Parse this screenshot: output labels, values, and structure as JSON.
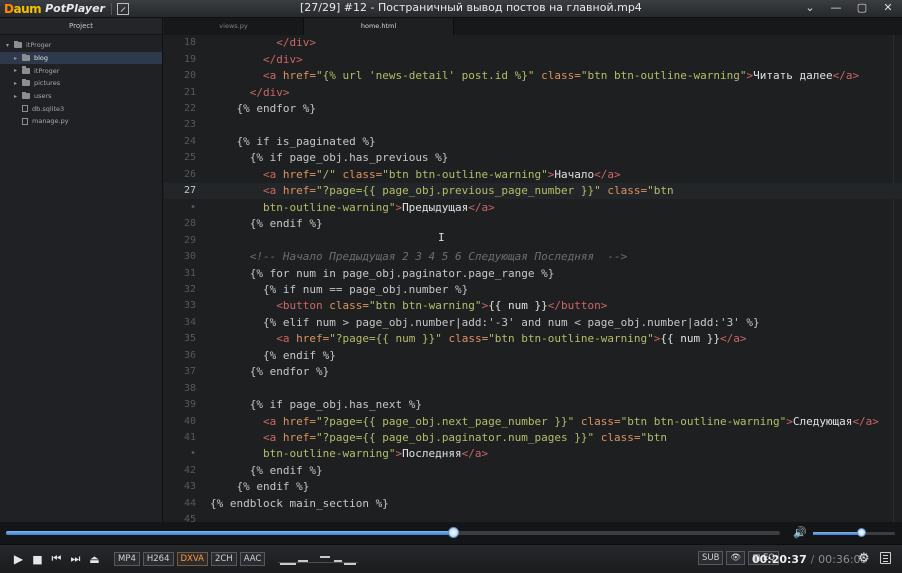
{
  "player": {
    "logo": "Daum",
    "app_name": "PotPlayer",
    "title": "[27/29] #12 - Постраничный вывод постов на главной.mp4",
    "window_buttons": [
      "⌄",
      "—",
      "▢",
      "✕"
    ]
  },
  "sidebar": {
    "header": "Project",
    "items": [
      {
        "label": "itProger",
        "kind": "folder",
        "level": 0,
        "selected": false
      },
      {
        "label": "blog",
        "kind": "folder",
        "level": 1,
        "selected": true
      },
      {
        "label": "itProger",
        "kind": "folder",
        "level": 1,
        "selected": false
      },
      {
        "label": "pictures",
        "kind": "folder",
        "level": 1,
        "selected": false
      },
      {
        "label": "users",
        "kind": "folder",
        "level": 1,
        "selected": false
      },
      {
        "label": "db.sqlite3",
        "kind": "file",
        "level": 1,
        "selected": false
      },
      {
        "label": "manage.py",
        "kind": "file",
        "level": 1,
        "selected": false
      }
    ]
  },
  "tabs": [
    {
      "label": "views.py",
      "active": false
    },
    {
      "label": "home.html",
      "active": true
    }
  ],
  "editor": {
    "current_line": "27",
    "lines": [
      {
        "n": "18",
        "indent": 10,
        "tokens": [
          [
            "tag",
            "</div>"
          ]
        ]
      },
      {
        "n": "19",
        "indent": 8,
        "tokens": [
          [
            "tag",
            "</div>"
          ]
        ]
      },
      {
        "n": "20",
        "indent": 8,
        "tokens": [
          [
            "tag",
            "<a "
          ],
          [
            "attr",
            "href="
          ],
          [
            "str",
            "\"{% url 'news-detail' post.id %}\""
          ],
          [
            "attr",
            " class="
          ],
          [
            "str",
            "\"btn btn-outline-warning\""
          ],
          [
            "tag",
            ">"
          ],
          [
            "txt",
            "Читать далее"
          ],
          [
            "tag",
            "</a>"
          ]
        ]
      },
      {
        "n": "21",
        "indent": 6,
        "tokens": [
          [
            "tag",
            "</div>"
          ]
        ]
      },
      {
        "n": "22",
        "indent": 4,
        "tokens": [
          [
            "tpl",
            "{% endfor %}"
          ]
        ]
      },
      {
        "n": "23",
        "indent": 0,
        "tokens": []
      },
      {
        "n": "24",
        "indent": 4,
        "tokens": [
          [
            "tpl",
            "{% if is_paginated %}"
          ]
        ]
      },
      {
        "n": "25",
        "indent": 6,
        "tokens": [
          [
            "tpl",
            "{% if page_obj.has_previous %}"
          ]
        ]
      },
      {
        "n": "26",
        "indent": 8,
        "tokens": [
          [
            "tag",
            "<a "
          ],
          [
            "attr",
            "href="
          ],
          [
            "str",
            "\"/\""
          ],
          [
            "attr",
            " class="
          ],
          [
            "str",
            "\"btn btn-outline-warning\""
          ],
          [
            "tag",
            ">"
          ],
          [
            "txt",
            "Начало"
          ],
          [
            "tag",
            "</a>"
          ]
        ]
      },
      {
        "n": "27",
        "indent": 8,
        "tokens": [
          [
            "tag",
            "<a "
          ],
          [
            "attr",
            "href="
          ],
          [
            "str",
            "\"?page={{ page_obj.previous_page_number }}\""
          ],
          [
            "attr",
            " class="
          ],
          [
            "str",
            "\"btn"
          ]
        ]
      },
      {
        "n": "•",
        "indent": 8,
        "tokens": [
          [
            "str",
            "btn-outline-warning\""
          ],
          [
            "tag",
            ">"
          ],
          [
            "txt",
            "Предыдущая"
          ],
          [
            "tag",
            "</a>"
          ]
        ]
      },
      {
        "n": "28",
        "indent": 6,
        "tokens": [
          [
            "tpl",
            "{% endif %}"
          ]
        ]
      },
      {
        "n": "29",
        "indent": 0,
        "tokens": []
      },
      {
        "n": "30",
        "indent": 6,
        "tokens": [
          [
            "cmt",
            "<!-- Начало Предыдущая 2 3 4 5 6 Следующая Последняя  -->"
          ]
        ]
      },
      {
        "n": "31",
        "indent": 6,
        "tokens": [
          [
            "tpl",
            "{% for num in page_obj.paginator.page_range %}"
          ]
        ]
      },
      {
        "n": "32",
        "indent": 8,
        "tokens": [
          [
            "tpl",
            "{% if num == page_obj.number %}"
          ]
        ]
      },
      {
        "n": "33",
        "indent": 10,
        "tokens": [
          [
            "tag",
            "<button "
          ],
          [
            "attr",
            "class="
          ],
          [
            "str",
            "\"btn btn-warning\""
          ],
          [
            "tag",
            ">"
          ],
          [
            "txt",
            "{{ num }}"
          ],
          [
            "tag",
            "</button>"
          ]
        ]
      },
      {
        "n": "34",
        "indent": 8,
        "tokens": [
          [
            "tpl",
            "{% elif num > page_obj.number|add:'-3' and num < page_obj.number|add:'3' %}"
          ]
        ]
      },
      {
        "n": "35",
        "indent": 10,
        "tokens": [
          [
            "tag",
            "<a "
          ],
          [
            "attr",
            "href="
          ],
          [
            "str",
            "\"?page={{ num }}\""
          ],
          [
            "attr",
            " class="
          ],
          [
            "str",
            "\"btn btn-outline-warning\""
          ],
          [
            "tag",
            ">"
          ],
          [
            "txt",
            "{{ num }}"
          ],
          [
            "tag",
            "</a>"
          ]
        ]
      },
      {
        "n": "36",
        "indent": 8,
        "tokens": [
          [
            "tpl",
            "{% endif %}"
          ]
        ]
      },
      {
        "n": "37",
        "indent": 6,
        "tokens": [
          [
            "tpl",
            "{% endfor %}"
          ]
        ]
      },
      {
        "n": "38",
        "indent": 0,
        "tokens": []
      },
      {
        "n": "39",
        "indent": 6,
        "tokens": [
          [
            "tpl",
            "{% if page_obj.has_next %}"
          ]
        ]
      },
      {
        "n": "40",
        "indent": 8,
        "tokens": [
          [
            "tag",
            "<a "
          ],
          [
            "attr",
            "href="
          ],
          [
            "str",
            "\"?page={{ page_obj.next_page_number }}\""
          ],
          [
            "attr",
            " class="
          ],
          [
            "str",
            "\"btn btn-outline-warning\""
          ],
          [
            "tag",
            ">"
          ],
          [
            "txt",
            "Следующая"
          ],
          [
            "tag",
            "</a>"
          ]
        ]
      },
      {
        "n": "41",
        "indent": 8,
        "tokens": [
          [
            "tag",
            "<a "
          ],
          [
            "attr",
            "href="
          ],
          [
            "str",
            "\"?page={{ page_obj.paginator.num_pages }}\""
          ],
          [
            "attr",
            " class="
          ],
          [
            "str",
            "\"btn"
          ]
        ]
      },
      {
        "n": "•",
        "indent": 8,
        "tokens": [
          [
            "str",
            "btn-outline-warning\""
          ],
          [
            "tag",
            ">"
          ],
          [
            "txt",
            "Последняя"
          ],
          [
            "tag",
            "</a>"
          ]
        ]
      },
      {
        "n": "42",
        "indent": 6,
        "tokens": [
          [
            "tpl",
            "{% endif %}"
          ]
        ]
      },
      {
        "n": "43",
        "indent": 4,
        "tokens": [
          [
            "tpl",
            "{% endif %}"
          ]
        ]
      },
      {
        "n": "44",
        "indent": 0,
        "tokens": [
          [
            "tpl",
            "{% endblock main_section %}"
          ]
        ]
      },
      {
        "n": "45",
        "indent": 0,
        "tokens": []
      }
    ]
  },
  "playback": {
    "progress": 0.5776,
    "volume": 0.6,
    "badges": [
      "MP4",
      "H264",
      "DXVA",
      "2CH",
      "AAC"
    ],
    "highlight_badge": "DXVA",
    "right_badges": [
      "SUB",
      "👁",
      "▤ EQ"
    ],
    "elapsed": "00:20:37",
    "separator": "/",
    "total": "00:36:05"
  },
  "colors": {
    "accent": "#4f8fdc",
    "tag": "#cc6666",
    "attr": "#de935f",
    "string": "#b5bd68",
    "comment": "#6b6f73"
  }
}
